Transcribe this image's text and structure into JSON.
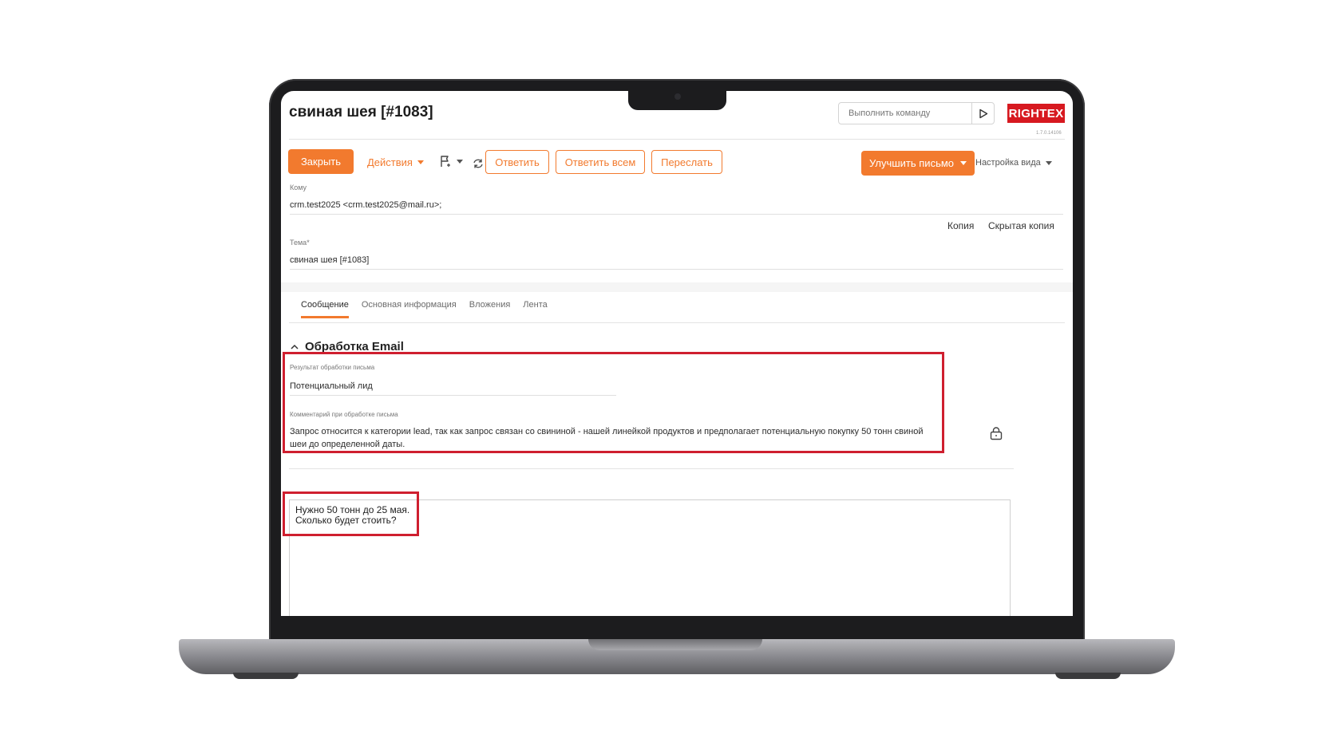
{
  "header": {
    "title": "свиная шея [#1083]",
    "command_placeholder": "Выполнить команду",
    "logo_text": "RIGHTEX",
    "version": "1.7.0.14106"
  },
  "toolbar": {
    "close_label": "Закрыть",
    "actions_label": "Действия",
    "reply_label": "Ответить",
    "reply_all_label": "Ответить всем",
    "forward_label": "Переслать",
    "improve_label": "Улучшить письмо",
    "view_settings_label": "Настройка вида"
  },
  "fields": {
    "to_label": "Кому",
    "to_value": "crm.test2025 <crm.test2025@mail.ru>;",
    "cc_label": "Копия",
    "bcc_label": "Скрытая копия",
    "subject_label": "Тема*",
    "subject_value": "свиная шея [#1083]"
  },
  "tabs": [
    {
      "label": "Сообщение",
      "active": true
    },
    {
      "label": "Основная информация",
      "active": false
    },
    {
      "label": "Вложения",
      "active": false
    },
    {
      "label": "Лента",
      "active": false
    }
  ],
  "email_processing": {
    "section_title": "Обработка Email",
    "result_label": "Результат обработки письма",
    "result_value": "Потенциальный лид",
    "comment_label": "Комментарий при обработке письма",
    "comment_value": "Запрос относится к категории lead, так как запрос связан со свининой - нашей линейкой продуктов и предполагает потенциальную покупку 50 тонн свиной шеи до определенной даты."
  },
  "message": {
    "line1": "Нужно 50 тонн до 25 мая.",
    "line2": "Сколько будет стоить?"
  },
  "colors": {
    "accent": "#f27a2e",
    "highlight": "#cf1f2f",
    "logo_bg": "#d71920"
  }
}
